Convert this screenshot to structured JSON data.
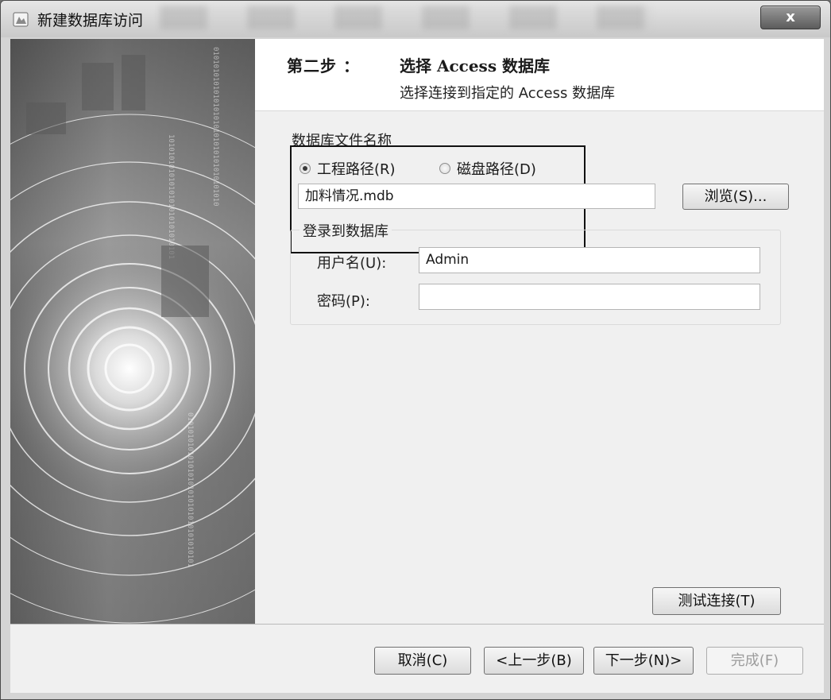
{
  "window": {
    "title": "新建数据库访问",
    "close_symbol": "x"
  },
  "header": {
    "step_label": "第二步 ：",
    "step_title": "选择 Access 数据库",
    "step_description": "选择连接到指定的 Access 数据库"
  },
  "file_group": {
    "label": "数据库文件名称",
    "radio_project": {
      "label": "工程路径(R)",
      "selected": true
    },
    "radio_disk": {
      "label": "磁盘路径(D)",
      "selected": false
    },
    "filename_value": "加料情况.mdb",
    "browse_label": "浏览(S)..."
  },
  "login_group": {
    "label": "登录到数据库",
    "username_label": "用户名(U):",
    "username_value": "Admin",
    "password_label": "密码(P):",
    "password_value": ""
  },
  "buttons": {
    "test_connection": "测试连接(T)",
    "cancel": "取消(C)",
    "back": "<上一步(B)",
    "next": "下一步(N)>",
    "finish": "完成(F)"
  },
  "icons": {
    "app": "database-icon",
    "close": "close-icon"
  }
}
